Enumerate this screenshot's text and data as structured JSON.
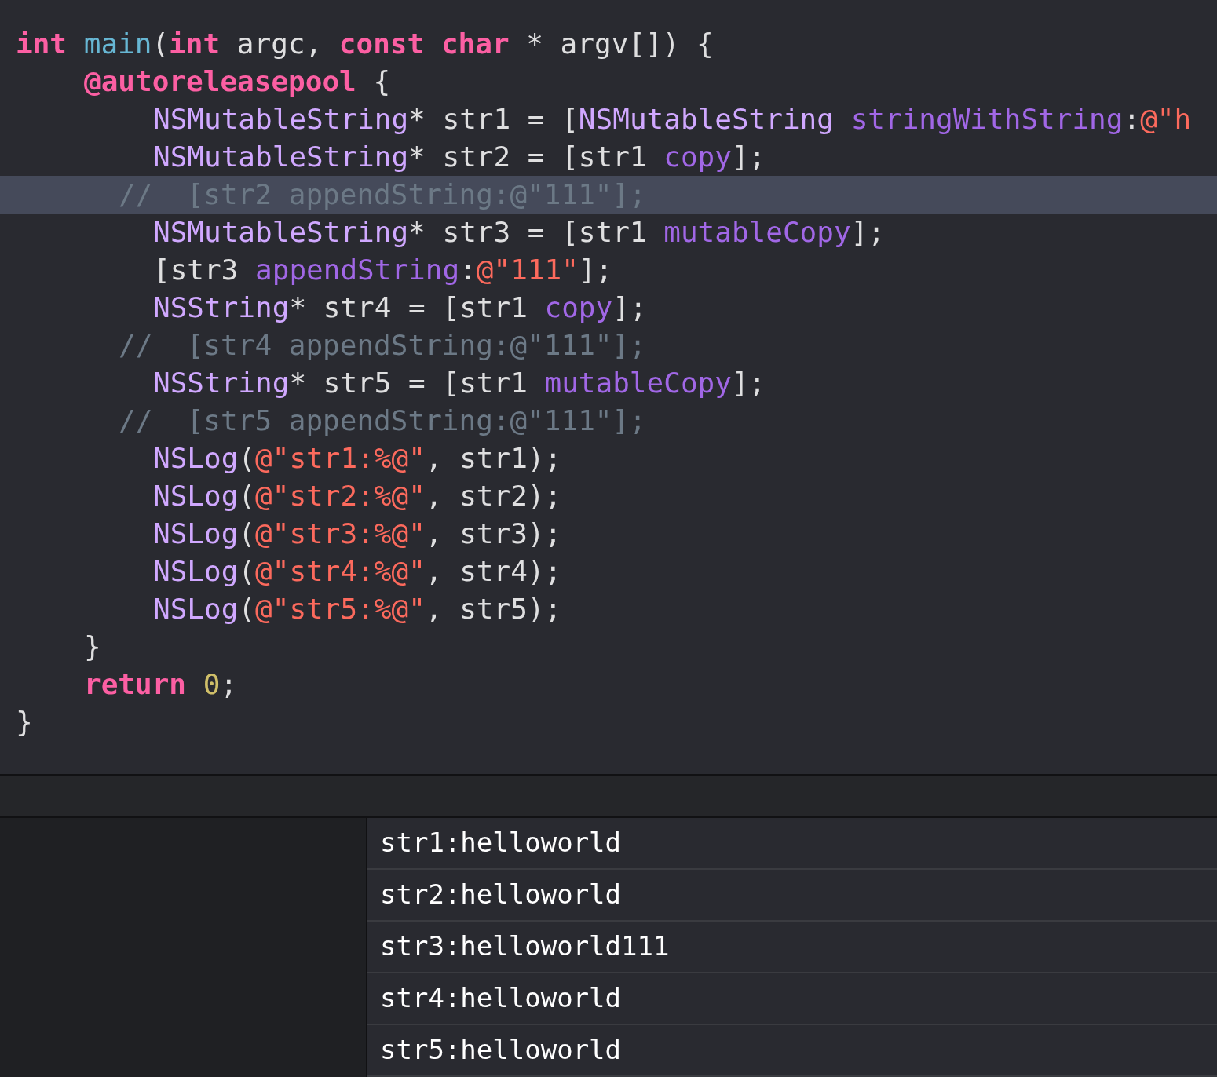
{
  "editor": {
    "lines": [
      {
        "highlighted": false,
        "kind": "signature",
        "tokens": [
          {
            "kind": "keyword",
            "text": "int"
          },
          {
            "kind": "function",
            "text": " main"
          },
          {
            "kind": "plain",
            "text": "("
          },
          {
            "kind": "keyword",
            "text": "int"
          },
          {
            "kind": "plain",
            "text": " argc, "
          },
          {
            "kind": "keyword",
            "text": "const"
          },
          {
            "kind": "keyword",
            "text": " char"
          },
          {
            "kind": "plain",
            "text": " * argv[]) {"
          }
        ]
      },
      {
        "highlighted": false,
        "kind": "block",
        "tokens": [
          {
            "kind": "keyword",
            "text": "@autoreleasepool"
          },
          {
            "kind": "plain",
            "text": " {"
          }
        ]
      },
      {
        "highlighted": false,
        "kind": "body",
        "tokens": [
          {
            "kind": "type",
            "text": "NSMutableString"
          },
          {
            "kind": "plain",
            "text": "* str1 = ["
          },
          {
            "kind": "type",
            "text": "NSMutableString"
          },
          {
            "kind": "method",
            "text": " stringWithString"
          },
          {
            "kind": "plain",
            "text": ":"
          },
          {
            "kind": "string",
            "text": "@\"h"
          }
        ]
      },
      {
        "highlighted": false,
        "kind": "body",
        "tokens": [
          {
            "kind": "type",
            "text": "NSMutableString"
          },
          {
            "kind": "plain",
            "text": "* str2 = [str1 "
          },
          {
            "kind": "method",
            "text": "copy"
          },
          {
            "kind": "plain",
            "text": "];"
          }
        ]
      },
      {
        "highlighted": true,
        "kind": "comment",
        "tokens": [
          {
            "kind": "comment",
            "text": "//  [str2 appendString:@\"111\"];"
          }
        ]
      },
      {
        "highlighted": false,
        "kind": "body",
        "tokens": [
          {
            "kind": "type",
            "text": "NSMutableString"
          },
          {
            "kind": "plain",
            "text": "* str3 = [str1 "
          },
          {
            "kind": "method",
            "text": "mutableCopy"
          },
          {
            "kind": "plain",
            "text": "];"
          }
        ]
      },
      {
        "highlighted": false,
        "kind": "body",
        "tokens": [
          {
            "kind": "plain",
            "text": "[str3 "
          },
          {
            "kind": "method",
            "text": "appendString"
          },
          {
            "kind": "plain",
            "text": ":"
          },
          {
            "kind": "string",
            "text": "@\"111\""
          },
          {
            "kind": "plain",
            "text": "];"
          }
        ]
      },
      {
        "highlighted": false,
        "kind": "body",
        "tokens": [
          {
            "kind": "type",
            "text": "NSString"
          },
          {
            "kind": "plain",
            "text": "* str4 = [str1 "
          },
          {
            "kind": "method",
            "text": "copy"
          },
          {
            "kind": "plain",
            "text": "];"
          }
        ]
      },
      {
        "highlighted": false,
        "kind": "comment",
        "tokens": [
          {
            "kind": "comment",
            "text": "//  [str4 appendString:@\"111\"];"
          }
        ]
      },
      {
        "highlighted": false,
        "kind": "body",
        "tokens": [
          {
            "kind": "type",
            "text": "NSString"
          },
          {
            "kind": "plain",
            "text": "* str5 = [str1 "
          },
          {
            "kind": "method",
            "text": "mutableCopy"
          },
          {
            "kind": "plain",
            "text": "];"
          }
        ]
      },
      {
        "highlighted": false,
        "kind": "comment",
        "tokens": [
          {
            "kind": "comment",
            "text": "//  [str5 appendString:@\"111\"];"
          }
        ]
      },
      {
        "highlighted": false,
        "kind": "body",
        "tokens": [
          {
            "kind": "type",
            "text": "NSLog"
          },
          {
            "kind": "plain",
            "text": "("
          },
          {
            "kind": "string",
            "text": "@\"str1:%@\""
          },
          {
            "kind": "plain",
            "text": ", str1);"
          }
        ]
      },
      {
        "highlighted": false,
        "kind": "body",
        "tokens": [
          {
            "kind": "type",
            "text": "NSLog"
          },
          {
            "kind": "plain",
            "text": "("
          },
          {
            "kind": "string",
            "text": "@\"str2:%@\""
          },
          {
            "kind": "plain",
            "text": ", str2);"
          }
        ]
      },
      {
        "highlighted": false,
        "kind": "body",
        "tokens": [
          {
            "kind": "type",
            "text": "NSLog"
          },
          {
            "kind": "plain",
            "text": "("
          },
          {
            "kind": "string",
            "text": "@\"str3:%@\""
          },
          {
            "kind": "plain",
            "text": ", str3);"
          }
        ]
      },
      {
        "highlighted": false,
        "kind": "body",
        "tokens": [
          {
            "kind": "type",
            "text": "NSLog"
          },
          {
            "kind": "plain",
            "text": "("
          },
          {
            "kind": "string",
            "text": "@\"str4:%@\""
          },
          {
            "kind": "plain",
            "text": ", str4);"
          }
        ]
      },
      {
        "highlighted": false,
        "kind": "body",
        "tokens": [
          {
            "kind": "type",
            "text": "NSLog"
          },
          {
            "kind": "plain",
            "text": "("
          },
          {
            "kind": "string",
            "text": "@\"str5:%@\""
          },
          {
            "kind": "plain",
            "text": ", str5);"
          }
        ]
      },
      {
        "highlighted": false,
        "kind": "block",
        "tokens": [
          {
            "kind": "plain",
            "text": "}"
          }
        ]
      },
      {
        "highlighted": false,
        "kind": "block",
        "tokens": [
          {
            "kind": "keyword",
            "text": "return"
          },
          {
            "kind": "number",
            "text": " 0"
          },
          {
            "kind": "plain",
            "text": ";"
          }
        ]
      },
      {
        "highlighted": false,
        "kind": "signature",
        "tokens": [
          {
            "kind": "plain",
            "text": "}"
          }
        ]
      }
    ]
  },
  "console": {
    "rows": [
      "str1:helloworld",
      "str2:helloworld",
      "str3:helloworld111",
      "str4:helloworld",
      "str5:helloworld"
    ]
  }
}
